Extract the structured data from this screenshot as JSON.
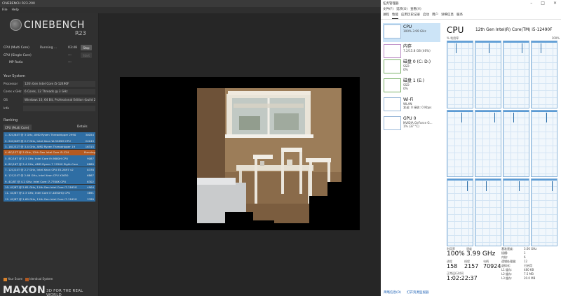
{
  "cinebench": {
    "window_title": "CINEBENCH R23.200",
    "menu": [
      "File",
      "Help"
    ],
    "logo_text": "CINEBENCH",
    "logo_version": "R23",
    "tests": [
      {
        "name": "CPU (Multi Core)",
        "status": "Running ...",
        "time": "03:48",
        "button": "Stop"
      },
      {
        "name": "CPU (Single Core)",
        "status": "",
        "time": "---",
        "button": "Start"
      },
      {
        "name": "MP Ratio",
        "status": "",
        "time": "---",
        "button": ""
      }
    ],
    "system_label": "Your System",
    "system": [
      {
        "key": "Processor",
        "value": "12th Gen Intel Core i5-12490F"
      },
      {
        "key": "Cores x GHz",
        "value": "6 Cores, 12 Threads @ 3 GHz"
      },
      {
        "key": "OS",
        "value": "Windows 10, 64 Bit, Professional Edition (build 2"
      },
      {
        "key": "Info",
        "value": ""
      }
    ],
    "ranking_label": "Ranking",
    "ranking_select": "CPU (Multi Core)",
    "details_label": "Details",
    "ranking": [
      {
        "text": "1. 32C/64T @ 3 GHz, AMD Ryzen Threadripper 2990",
        "score": "30054",
        "color": "#2f6ea4"
      },
      {
        "text": "2. 24C/48T @ 2.7 GHz, Intel Xeon W-3265M CPU",
        "score": "24243",
        "color": "#2f6ea4"
      },
      {
        "text": "3. 16C/32T @ 3.4 GHz, AMD Ryzen Threadripper 19",
        "score": "16315",
        "color": "#2f6ea4"
      },
      {
        "text": "4. 6C/12T @ 3 GHz, 12th Gen Intel Core i5-124",
        "score": "Running ...",
        "color": "#b45a22"
      },
      {
        "text": "5. 8C/16T @ 2.3 GHz, Intel Core i9-9880H CPU",
        "score": "9087",
        "color": "#2f6ea4"
      },
      {
        "text": "6. 8C/16T @ 3.4 GHz, AMD Ryzen 7 1700X Eight-Core",
        "score": "8889",
        "color": "#2f6ea4"
      },
      {
        "text": "7. 12C/24T @ 2.7 GHz, Intel Xeon CPU E5-2697 v2",
        "score": "8378",
        "color": "#2f6ea4"
      },
      {
        "text": "8. 12C/24T @ 2.66 GHz, Intel Xeon CPU X5650",
        "score": "6867",
        "color": "#2f6ea4"
      },
      {
        "text": "9. 4C/8T @ 4.2 GHz, Intel Core i7-7700K CPU",
        "score": "6302",
        "color": "#2f6ea4"
      },
      {
        "text": "10. 4C/8T @ 2.81 GHz, 11th Gen Intel Core i7-1165G",
        "score": "4904",
        "color": "#2f6ea4"
      },
      {
        "text": "11. 4C/8T @ 2.3 GHz, Intel Core i7-4850HQ CPU",
        "score": "3891",
        "color": "#2f6ea4"
      },
      {
        "text": "12. 4C/8T @ 1.69 GHz, 11th Gen Intel Core i7-1165G",
        "score": "3769",
        "color": "#2f6ea4"
      }
    ],
    "legend": [
      {
        "label": "Your Score",
        "color": "#d9822b"
      },
      {
        "label": "Identical System",
        "color": "#b45a22"
      }
    ],
    "maxon": "MAXON",
    "tagline": "3D FOR THE REAL WORLD"
  },
  "taskmgr": {
    "window_title": "任务管理器",
    "menu": [
      "文件(F)",
      "选项(O)",
      "查看(V)"
    ],
    "tabs": [
      "进程",
      "性能",
      "应用历史记录",
      "启动",
      "用户",
      "详细信息",
      "服务"
    ],
    "active_tab": "性能",
    "side": [
      {
        "title": "CPU",
        "sub1": "100% 3.99 GHz",
        "sub2": ""
      },
      {
        "title": "内存",
        "sub1": "7.2/15.8 GB (46%)",
        "sub2": ""
      },
      {
        "title": "磁盘 0 (C: D:)",
        "sub1": "SSD",
        "sub2": "0%"
      },
      {
        "title": "磁盘 1 (E:)",
        "sub1": "SSD",
        "sub2": "0%"
      },
      {
        "title": "Wi-Fi",
        "sub1": "WLAN",
        "sub2": "发送: 0 接收: 0 Kbps"
      },
      {
        "title": "GPU 0",
        "sub1": "NVIDIA GeForce G...",
        "sub2": "1% (37 °C)"
      }
    ],
    "cpu_heading": "CPU",
    "cpu_model": "12th Gen Intel(R) Core(TM) i5-12490F",
    "util_label": "% 利用率",
    "util_max": "100%",
    "stats": {
      "util_label": "利用率",
      "util_value": "100%",
      "speed_label": "速度",
      "speed_value": "3.99 GHz",
      "proc_label": "进程",
      "proc_value": "158",
      "thread_label": "线程",
      "thread_value": "2157",
      "handle_label": "句柄",
      "handle_value": "70924",
      "uptime_label": "正常运行时间",
      "uptime_value": "1:02:22:37"
    },
    "specs": [
      {
        "k": "基准速度:",
        "v": "3.00 GHz"
      },
      {
        "k": "插槽:",
        "v": "1"
      },
      {
        "k": "内核:",
        "v": "6"
      },
      {
        "k": "逻辑处理器:",
        "v": "12"
      },
      {
        "k": "虚拟化:",
        "v": "已启用"
      },
      {
        "k": "L1 缓存:",
        "v": "480 KB"
      },
      {
        "k": "L2 缓存:",
        "v": "7.5 MB"
      },
      {
        "k": "L3 缓存:",
        "v": "20.0 MB"
      }
    ],
    "footer": [
      "简略信息(D)",
      "打开资源监视器"
    ]
  },
  "colors": {
    "accent": "#2f6ea4",
    "tm_graph": "#5b9bd5"
  }
}
